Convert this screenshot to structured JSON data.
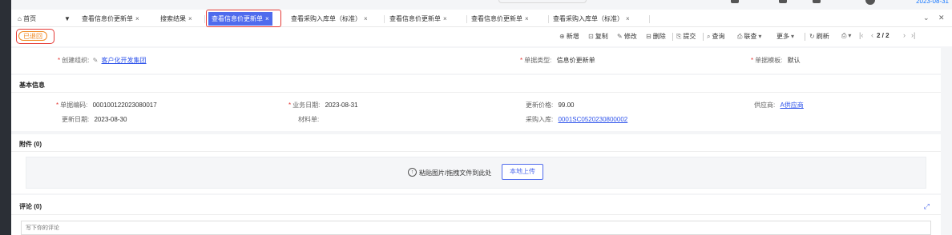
{
  "topbar": {
    "date": "2023-08-31"
  },
  "tabs": [
    {
      "label": "首页",
      "icon": "home-icon"
    },
    {
      "label": "查看信息价更新单"
    },
    {
      "label": "搜索结果"
    },
    {
      "label": "查看信息价更新单",
      "active": true
    },
    {
      "label": "查看采购入库单（标准）"
    },
    {
      "label": "查看信息价更新单"
    },
    {
      "label": "查看信息价更新单"
    },
    {
      "label": "查看采购入库单（标准）"
    }
  ],
  "tab_close": "×",
  "status_badge": "已退回",
  "toolbar": {
    "new": "新增",
    "copy": "复制",
    "edit": "修改",
    "delete": "删除",
    "submit": "提交",
    "query": "查询",
    "linked_query": "联查",
    "more": "更多",
    "refresh": "刷新",
    "page": "2 / 2"
  },
  "header_fields": {
    "org_label": "创建组织:",
    "org_value": "客户化开发集团",
    "type_label": "单据类型:",
    "type_value": "信息价更新单",
    "template_label": "单据模板:",
    "template_value": "默认"
  },
  "basic_info": {
    "title": "基本信息",
    "doc_no_label": "单据编码:",
    "doc_no_value": "000100122023080017",
    "biz_date_label": "业务日期:",
    "biz_date_value": "2023-08-31",
    "update_price_label": "更新价格:",
    "update_price_value": "99.00",
    "supplier_label": "供应商:",
    "supplier_value": "A供应商",
    "update_date_label": "更新日期:",
    "update_date_value": "2023-08-30",
    "material_label": "材料单:",
    "material_value": "",
    "purchase_label": "采购入库:",
    "purchase_value": "0001SC0520230800002"
  },
  "attachments": {
    "title": "附件 (0)",
    "paste_text": "粘贴图片/拖拽文件到此处",
    "upload_btn": "本地上传"
  },
  "comments": {
    "title": "评论 (0)",
    "placeholder": "写下你的评论"
  },
  "colors": {
    "accent": "#4f6bed",
    "status": "#f08a24",
    "highlight": "#e53935"
  }
}
